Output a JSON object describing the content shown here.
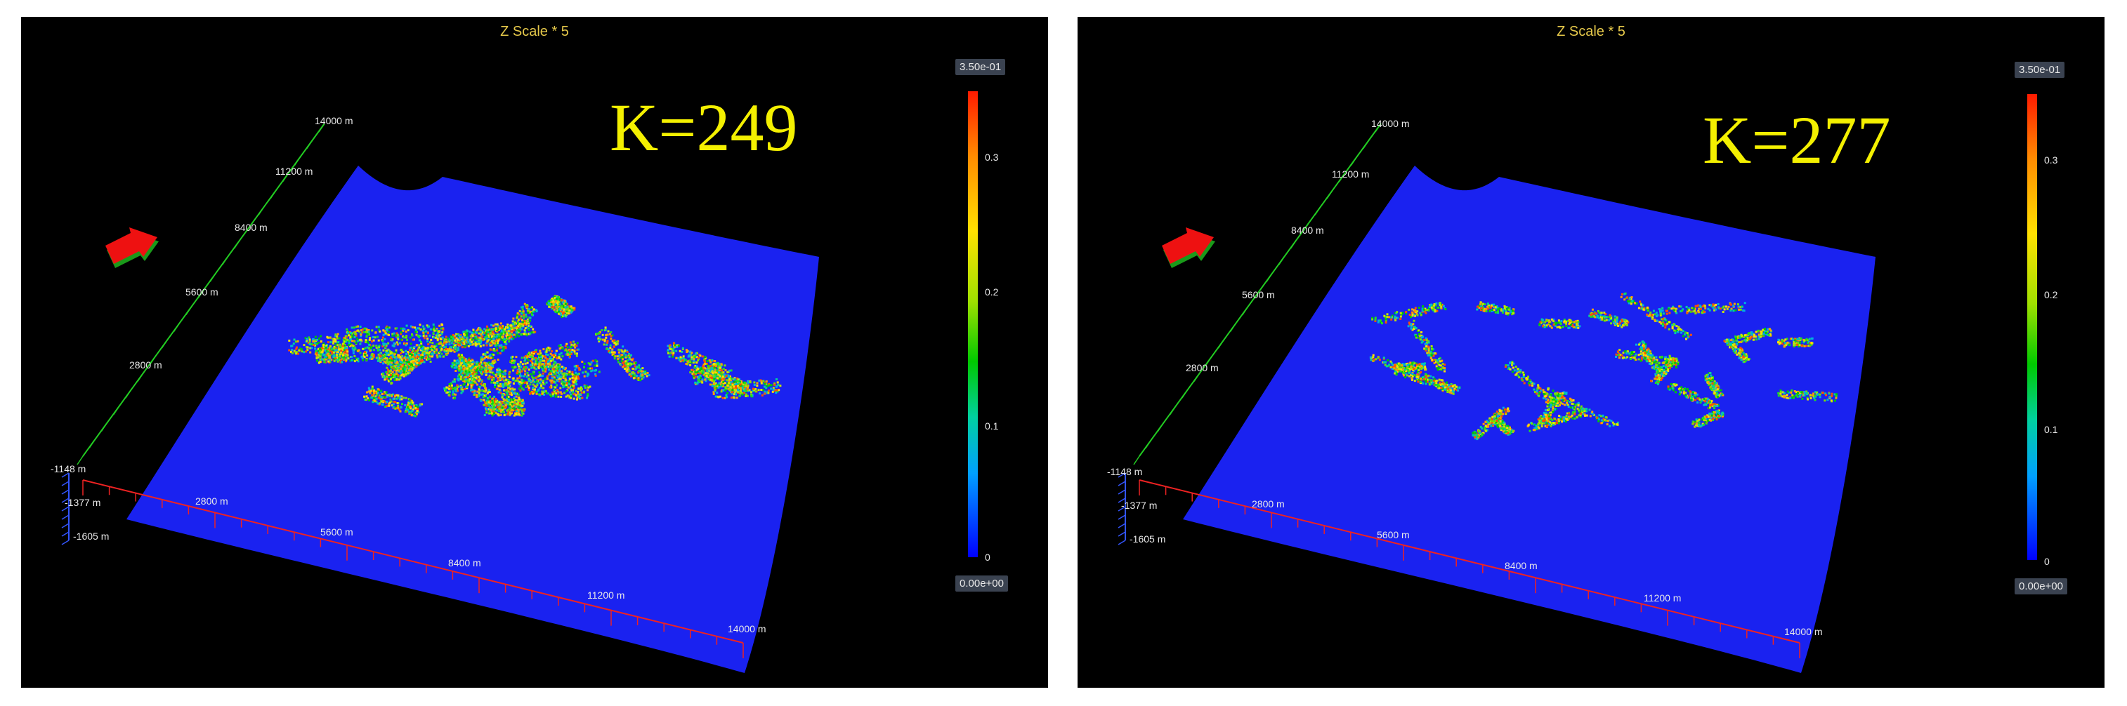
{
  "panels": [
    {
      "zscale_label": "Z Scale * 5",
      "k_label": "K=249",
      "colorbar": {
        "max_label": "3.50e-01",
        "min_label": "0.00e+00",
        "ticks": [
          "0.3",
          "0.2",
          "0.1",
          "0"
        ]
      },
      "y_axis": {
        "color": "#22cc22",
        "labels": [
          "14000 m",
          "11200 m",
          "8400 m",
          "5600 m",
          "2800 m"
        ]
      },
      "x_axis": {
        "color": "#ee2222",
        "labels": [
          "2800 m",
          "5600 m",
          "8400 m",
          "11200 m",
          "14000 m"
        ]
      },
      "z_axis": {
        "color": "#3355ff",
        "labels": [
          "-1148 m",
          "-1377 m",
          "-1605 m"
        ]
      }
    },
    {
      "zscale_label": "Z Scale * 5",
      "k_label": "K=277",
      "colorbar": {
        "max_label": "3.50e-01",
        "min_label": "0.00e+00",
        "ticks": [
          "0.3",
          "0.2",
          "0.1",
          "0"
        ]
      },
      "y_axis": {
        "color": "#22cc22",
        "labels": [
          "14000 m",
          "11200 m",
          "8400 m",
          "5600 m",
          "2800 m"
        ]
      },
      "x_axis": {
        "color": "#ee2222",
        "labels": [
          "2800 m",
          "5600 m",
          "8400 m",
          "11200 m",
          "14000 m"
        ]
      },
      "z_axis": {
        "color": "#3355ff",
        "labels": [
          "-1148 m",
          "-1377 m",
          "-1605 m"
        ]
      }
    }
  ],
  "colors": {
    "background": "#000000",
    "surface": "#1a1aff",
    "label_yellow": "#f4f000",
    "zscale_yellow": "#e5c84a"
  }
}
